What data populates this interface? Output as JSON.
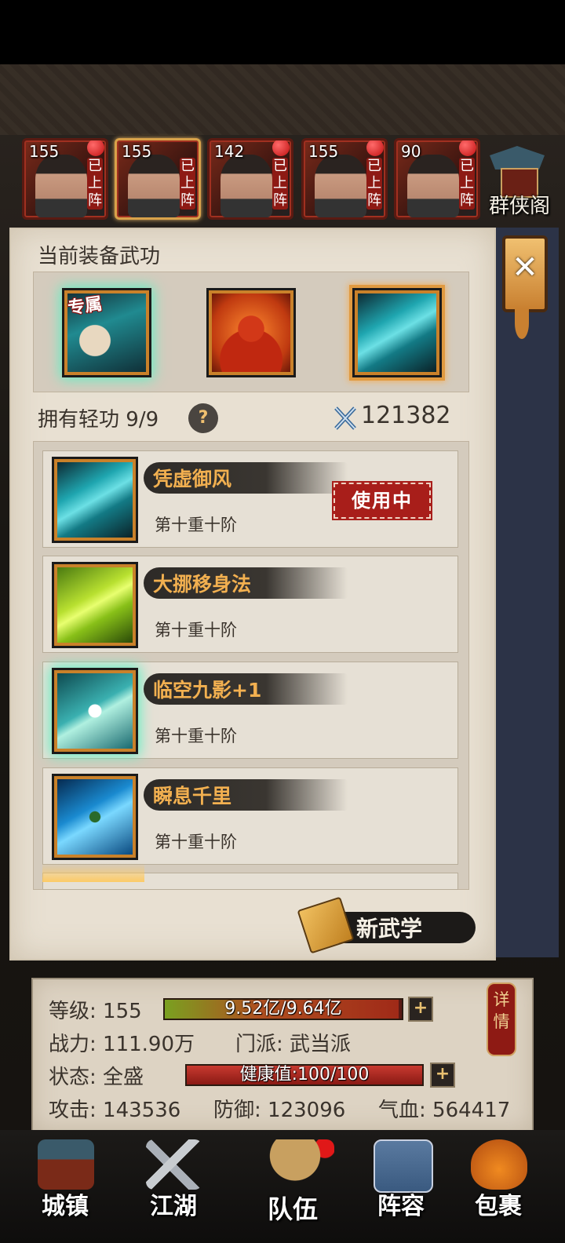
{
  "heroes": [
    {
      "level": "155",
      "tag": "已上阵",
      "selected": false
    },
    {
      "level": "155",
      "tag": "已上阵",
      "selected": true
    },
    {
      "level": "142",
      "tag": "已上阵",
      "selected": false
    },
    {
      "level": "155",
      "tag": "已上阵",
      "selected": false
    },
    {
      "level": "90",
      "tag": "已上阵",
      "selected": false
    }
  ],
  "guild_label": "群侠阁",
  "equipped": {
    "title": "当前装备武功",
    "exclusive_badge": "专属",
    "slots": [
      "hand-skill-icon",
      "inner-power-icon",
      "lightness-leg-icon"
    ]
  },
  "owned": {
    "label": "拥有轻功",
    "count": "9/9",
    "help": "?",
    "combat_power": "121382"
  },
  "skills": [
    {
      "name": "凭虚御风",
      "stage": "第十重十阶",
      "in_use": "使用中"
    },
    {
      "name": "大挪移身法",
      "stage": "第十重十阶"
    },
    {
      "name": "临空九影+1",
      "stage": "第十重十阶"
    },
    {
      "name": "瞬息千里",
      "stage": "第十重十阶"
    }
  ],
  "new_skill_button": "新武学",
  "stats": {
    "level_label": "等级:",
    "level": "155",
    "exp_text": "9.52亿/9.64亿",
    "exp_fraction": 0.9876,
    "power_label": "战力:",
    "power": "111.90万",
    "sect_label": "门派:",
    "sect": "武当派",
    "state_label": "状态:",
    "state": "全盛",
    "health_text": "健康值:100/100",
    "health_fraction": 1.0,
    "attack_label": "攻击:",
    "attack": "143536",
    "defense_label": "防御:",
    "defense": "123096",
    "hp_label": "气血:",
    "hp": "564417",
    "detail_button": "详情",
    "plus": "+"
  },
  "nav": [
    {
      "label": "城镇",
      "icon": "town-icon"
    },
    {
      "label": "江湖",
      "icon": "crossed-swords-icon"
    },
    {
      "label": "队伍",
      "icon": "team-icon",
      "active": true
    },
    {
      "label": "阵容",
      "icon": "formation-icon"
    },
    {
      "label": "包裹",
      "icon": "bag-icon"
    }
  ],
  "colors": {
    "accent_orange": "#f2b050",
    "in_use_red": "#a81e1a",
    "exp_bar": "#8a3a1a",
    "health_bar": "#b02a22"
  }
}
